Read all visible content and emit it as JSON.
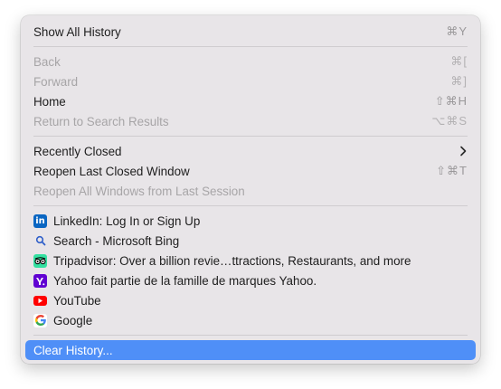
{
  "menu": {
    "show_all_history": {
      "label": "Show All History",
      "shortcut": "⌘Y"
    },
    "back": {
      "label": "Back",
      "shortcut": "⌘["
    },
    "forward": {
      "label": "Forward",
      "shortcut": "⌘]"
    },
    "home": {
      "label": "Home",
      "shortcut": "⇧⌘H"
    },
    "return_to_search": {
      "label": "Return to Search Results",
      "shortcut": "⌥⌘S"
    },
    "recently_closed": {
      "label": "Recently Closed"
    },
    "reopen_last_closed_window": {
      "label": "Reopen Last Closed Window",
      "shortcut": "⇧⌘T"
    },
    "reopen_all_windows": {
      "label": "Reopen All Windows from Last Session"
    },
    "history_items": [
      {
        "label": "LinkedIn: Log In or Sign Up",
        "icon": "linkedin-icon"
      },
      {
        "label": "Search - Microsoft Bing",
        "icon": "search-icon"
      },
      {
        "label": "Tripadvisor: Over a billion revie…ttractions, Restaurants, and more",
        "icon": "tripadvisor-icon"
      },
      {
        "label": "Yahoo fait partie de la famille de marques Yahoo.",
        "icon": "yahoo-icon"
      },
      {
        "label": "YouTube",
        "icon": "youtube-icon"
      },
      {
        "label": "Google",
        "icon": "google-icon"
      }
    ],
    "clear_history": {
      "label": "Clear History..."
    }
  },
  "colors": {
    "menu_background": "#e8e5e8",
    "selection": "#4f8ff7",
    "text": "#1e1e1e",
    "disabled_text": "#a7a5a7",
    "linkedin": "#0a66c2",
    "tripadvisor": "#34e0a1",
    "yahoo": "#6001d2",
    "youtube": "#ff0000"
  }
}
